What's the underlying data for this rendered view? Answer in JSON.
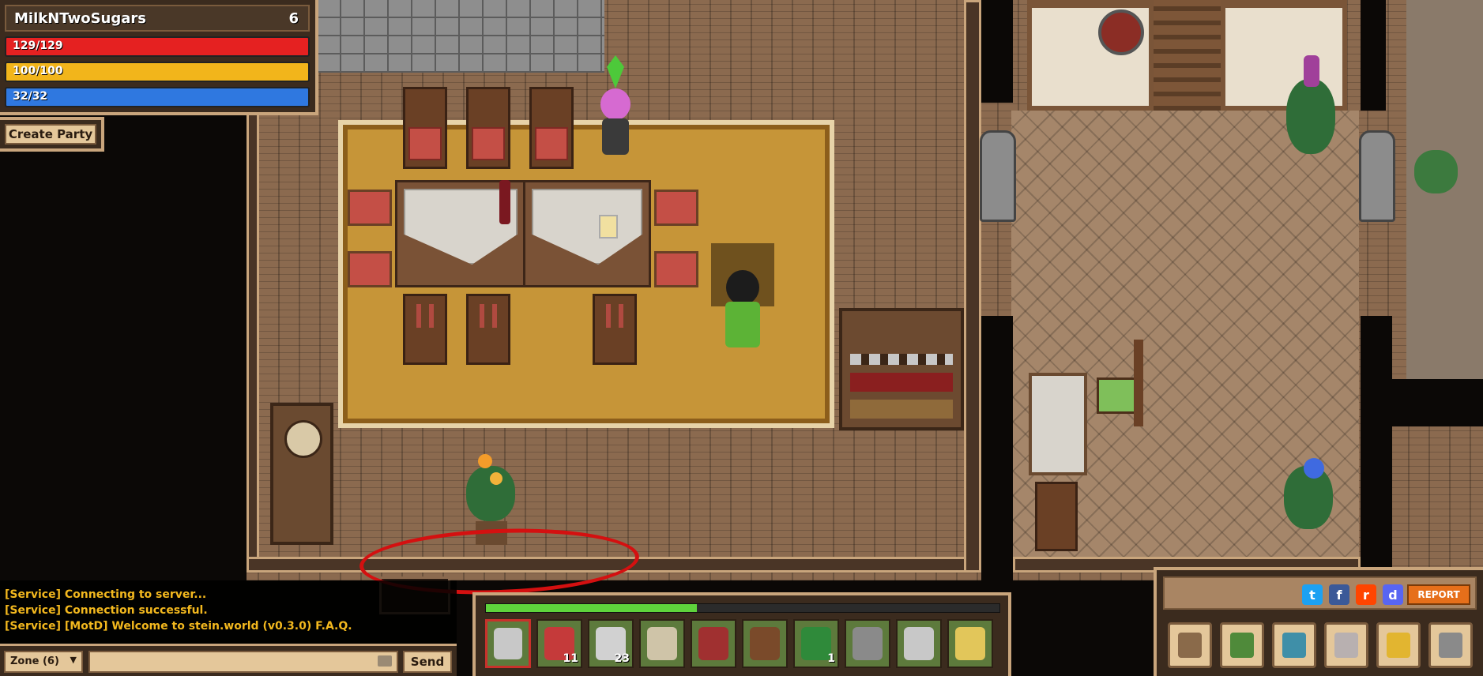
{
  "player": {
    "name": "MilkNTwoSugars",
    "level": "6",
    "health": {
      "label": "129/129",
      "fraction": 1.0,
      "color": "#e52121"
    },
    "stamina": {
      "label": "100/100",
      "fraction": 1.0,
      "color": "#f2b51b"
    },
    "mana": {
      "label": "32/32",
      "fraction": 1.0,
      "color": "#2f78e0"
    }
  },
  "party": {
    "create_label": "Create Party"
  },
  "chat": {
    "lines": [
      "[Service] Connecting to server...",
      "[Service] Connection successful.",
      "[Service] [MotD] Welcome to stein.world (v0.3.0)"
    ],
    "faq_link": "F.A.Q.",
    "zone_label": "Zone (6)",
    "input_value": "",
    "send_label": "Send"
  },
  "hotbar": {
    "xp_fraction": 0.41,
    "slots": [
      {
        "icon": "sword-icon",
        "count": ""
      },
      {
        "icon": "health-potion-icon",
        "count": "11"
      },
      {
        "icon": "mana-potion-icon",
        "count": "23"
      },
      {
        "icon": "armor-icon",
        "count": ""
      },
      {
        "icon": "hat-icon",
        "count": ""
      },
      {
        "icon": "club-icon",
        "count": ""
      },
      {
        "icon": "herb-icon",
        "count": "1"
      },
      {
        "icon": "pickaxe-icon",
        "count": ""
      },
      {
        "icon": "sword-icon",
        "count": ""
      },
      {
        "icon": "straw-hat-icon",
        "count": ""
      }
    ]
  },
  "menu": {
    "report_label": "REPORT",
    "social": [
      {
        "icon": "twitter-icon",
        "glyph": "t",
        "color": "#1da1f2"
      },
      {
        "icon": "facebook-icon",
        "glyph": "f",
        "color": "#3b5998"
      },
      {
        "icon": "reddit-icon",
        "glyph": "r",
        "color": "#ff4500"
      },
      {
        "icon": "discord-icon",
        "glyph": "d",
        "color": "#5865f2"
      }
    ],
    "buttons": [
      {
        "icon": "inventory-bag-icon",
        "color": "#8a6a4a"
      },
      {
        "icon": "quest-book-icon",
        "color": "#4f8a3a"
      },
      {
        "icon": "world-map-icon",
        "color": "#3f8fa8"
      },
      {
        "icon": "character-icon",
        "color": "#b8b0b0"
      },
      {
        "icon": "gold-coins-icon",
        "color": "#e2b530"
      },
      {
        "icon": "settings-gear-icon",
        "color": "#8a8a8a"
      }
    ]
  }
}
